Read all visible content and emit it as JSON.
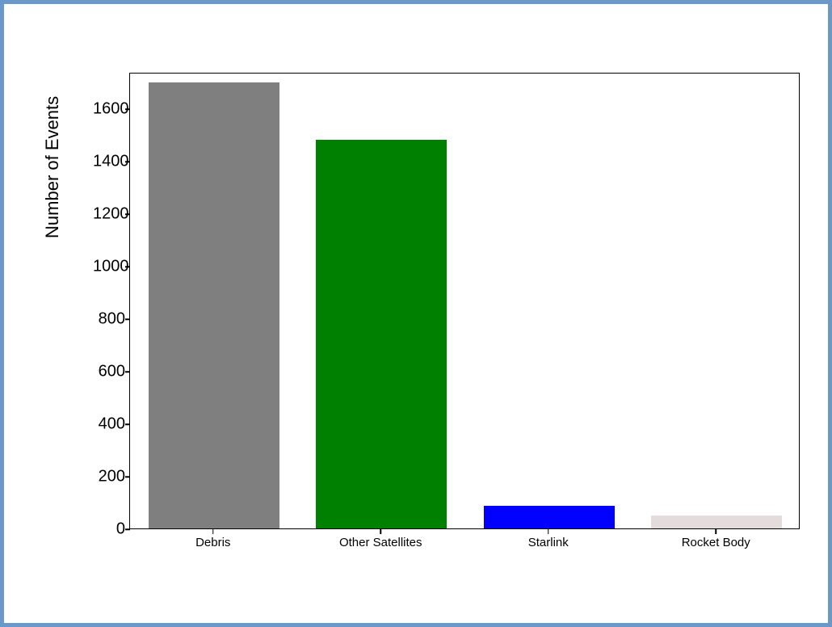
{
  "chart_data": {
    "type": "bar",
    "categories": [
      "Debris",
      "Other Satellites",
      "Starlink",
      "Rocket Body"
    ],
    "values": [
      1700,
      1480,
      85,
      50
    ],
    "colors": [
      "#7f7f7f",
      "#008000",
      "#0000ff",
      "#e4dbdd"
    ],
    "ylabel": "Number of Events",
    "xlabel": "",
    "title": "",
    "ylim": [
      0,
      1740
    ],
    "yticks": [
      0,
      200,
      400,
      600,
      800,
      1000,
      1200,
      1400,
      1600
    ]
  }
}
